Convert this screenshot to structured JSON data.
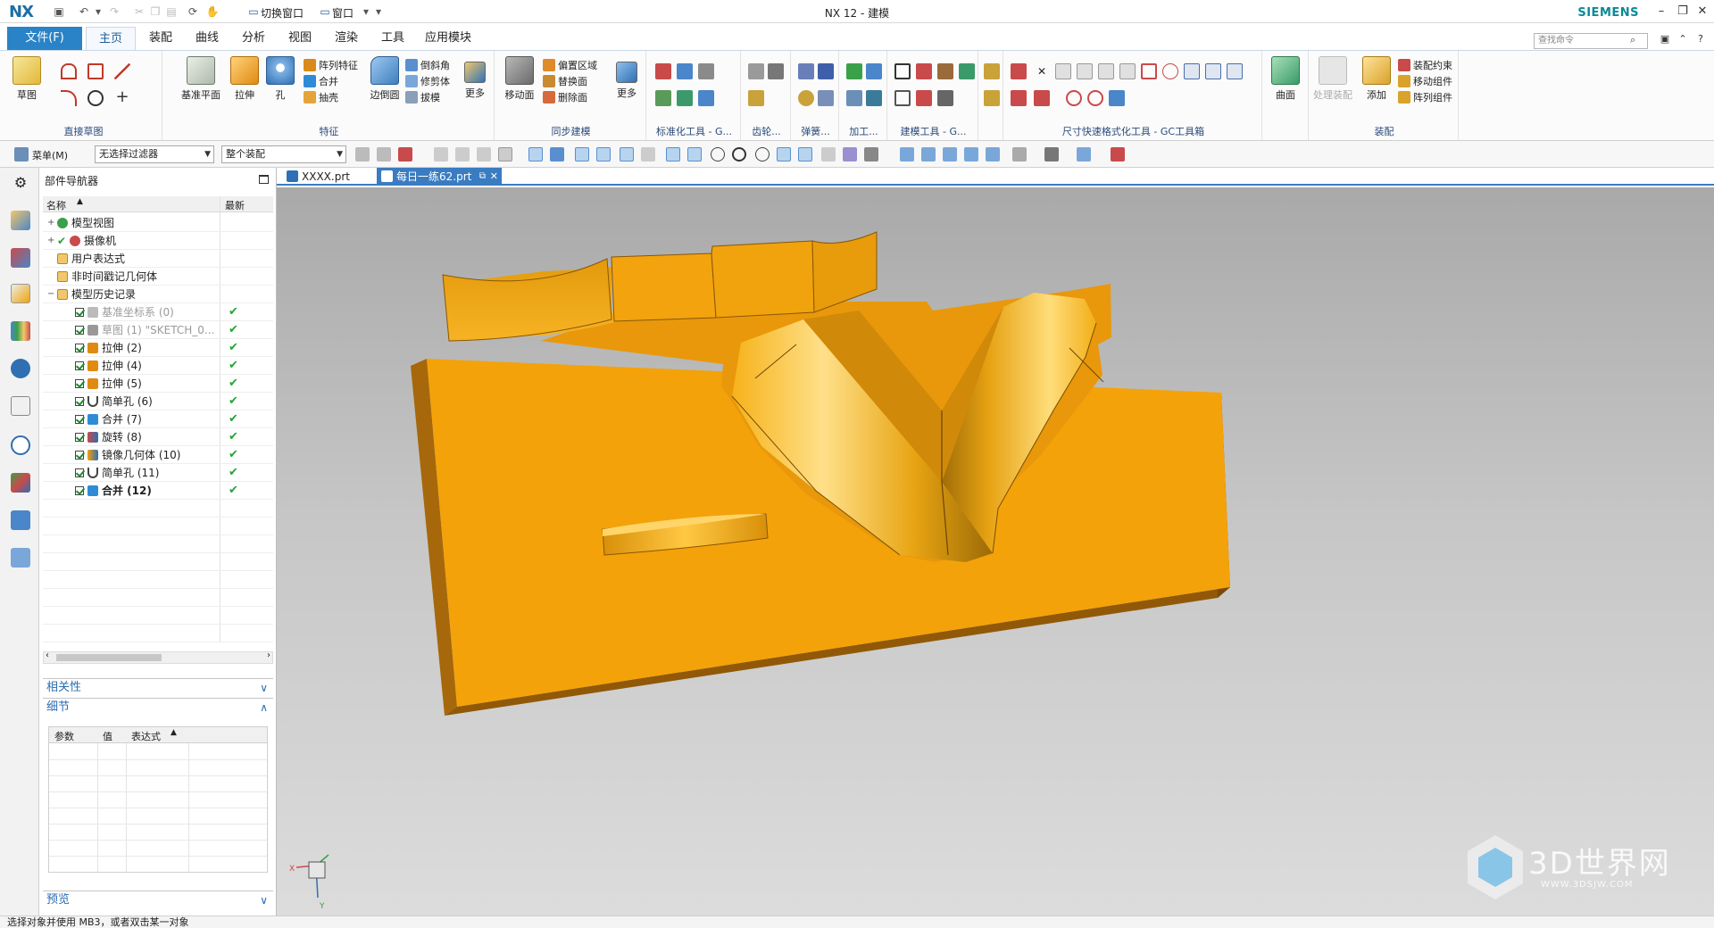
{
  "titlebar": {
    "logo": "NX",
    "switch_window": "切换窗口",
    "window_menu": "窗口",
    "title": "NX 12 - 建模",
    "brand": "SIEMENS"
  },
  "ribbon_tabs": {
    "file": "文件(F)",
    "tabs": [
      "主页",
      "装配",
      "曲线",
      "分析",
      "视图",
      "渲染",
      "工具",
      "应用模块"
    ],
    "active_index": 0,
    "search_placeholder": "查找命令"
  },
  "ribbon": {
    "groups": {
      "direct_sketch": "直接草图",
      "feature": "特征",
      "sync_modeling": "同步建模",
      "standard_tools": "标准化工具 - G...",
      "gear": "齿轮...",
      "spring": "弹簧...",
      "machining": "加工...",
      "modeling_tools": "建模工具 - G...",
      "dimension_tools": "尺寸快速格式化工具 - GC工具箱",
      "assembly": "装配"
    },
    "buttons": {
      "sketch": "草图",
      "datum_plane": "基准平面",
      "extrude": "拉伸",
      "hole": "孔",
      "pattern_feature": "阵列特征",
      "unite": "合并",
      "shell": "抽壳",
      "edge_blend": "边倒圆",
      "chamfer": "倒斜角",
      "trim_body": "修剪体",
      "draft": "拔模",
      "more1": "更多",
      "move_face": "移动面",
      "offset_region": "偏置区域",
      "replace_face": "替换面",
      "delete_face": "删除面",
      "more2": "更多",
      "surface": "曲面",
      "process_assembly": "处理装配",
      "add": "添加",
      "assembly_constraints": "装配约束",
      "move_component": "移动组件",
      "pattern_component": "阵列组件"
    }
  },
  "toolbar2": {
    "menu": "菜单(M)",
    "filter": "无选择过滤器",
    "scope": "整个装配"
  },
  "navigator": {
    "title": "部件导航器",
    "col_name": "名称",
    "col_latest": "最新",
    "rows": [
      {
        "label": "模型视图",
        "level": 0
      },
      {
        "label": "摄像机",
        "level": 0
      },
      {
        "label": "用户表达式",
        "level": 0
      },
      {
        "label": "非时间戳记几何体",
        "level": 0
      },
      {
        "label": "模型历史记录",
        "level": 0
      },
      {
        "label": "基准坐标系 (0)",
        "level": 1
      },
      {
        "label": "草图 (1) \"SKETCH_0...",
        "level": 1
      },
      {
        "label": "拉伸 (2)",
        "level": 1
      },
      {
        "label": "拉伸 (4)",
        "level": 1
      },
      {
        "label": "拉伸 (5)",
        "level": 1
      },
      {
        "label": "简单孔 (6)",
        "level": 1
      },
      {
        "label": "合并 (7)",
        "level": 1
      },
      {
        "label": "旋转 (8)",
        "level": 1
      },
      {
        "label": "镜像几何体 (10)",
        "level": 1
      },
      {
        "label": "简单孔 (11)",
        "level": 1
      },
      {
        "label": "合并 (12)",
        "level": 1
      }
    ],
    "sections": {
      "dependencies": "相关性",
      "details": "细节",
      "preview": "预览"
    },
    "detail_cols": [
      "参数",
      "值",
      "表达式"
    ]
  },
  "doc_tabs": [
    "XXXX.prt",
    "每日一练62.prt"
  ],
  "viewport": {
    "triad_x": "X",
    "triad_y": "Y",
    "model_color": "#f4a20a",
    "background_top": "#a9a9a9",
    "background_bottom": "#dcdcdc"
  },
  "watermark": {
    "brand": "3D世界网",
    "url": "WWW.3DSJW.COM"
  },
  "status": "选择对象并使用 MB3，或者双击某一对象"
}
